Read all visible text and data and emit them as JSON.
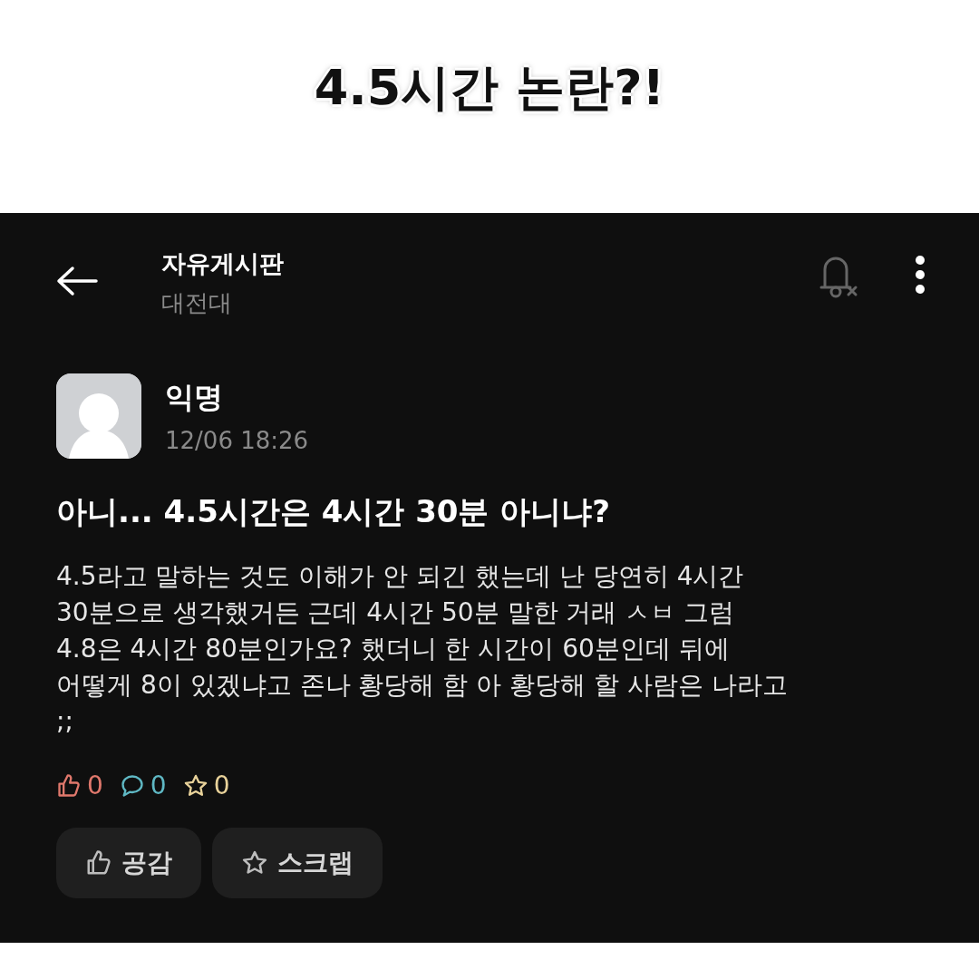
{
  "caption": "4.5시간 논란?!",
  "header": {
    "board": "자유게시판",
    "school": "대전대"
  },
  "post": {
    "author": "익명",
    "time": "12/06 18:26",
    "title": "아니... 4.5시간은 4시간 30분 아니냐?",
    "body_lines": [
      "4.5라고 말하는 것도 이해가 안 되긴 했는데 난 당연히 4시간",
      "30분으로 생각했거든 근데 4시간 50분 말한 거래 ㅅㅂ 그럼",
      "4.8은 4시간 80분인가요? 했더니 한 시간이 60분인데 뒤에",
      "어떻게 8이 있겠냐고 존나 황당해 함 아 황당해 할 사람은 나라고",
      ";;"
    ],
    "stats": [
      {
        "kind": "like",
        "count": "0",
        "color": "#e0786c"
      },
      {
        "kind": "comment",
        "count": "0",
        "color": "#5fb8c4"
      },
      {
        "kind": "scrap",
        "count": "0",
        "color": "#e8d29a"
      }
    ],
    "buttons": [
      {
        "kind": "like",
        "label": "공감"
      },
      {
        "kind": "scrap",
        "label": "스크랩"
      }
    ]
  }
}
